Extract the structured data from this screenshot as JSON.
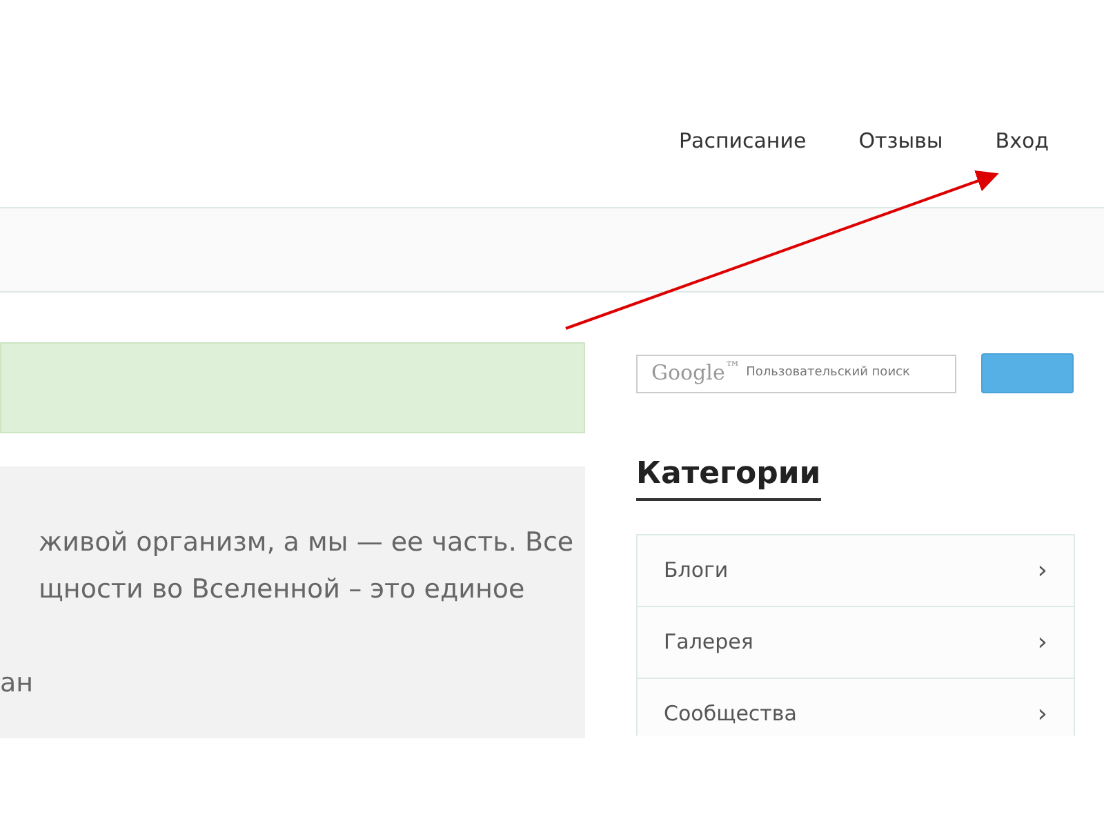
{
  "nav": [
    {
      "label": "Расписание"
    },
    {
      "label": "Отзывы"
    },
    {
      "label": "Вход"
    }
  ],
  "content": {
    "lines": [
      "живой организм, а мы — ее часть. Все",
      "щности во Вселенной – это единое"
    ],
    "tail_line": "ан"
  },
  "search": {
    "logo": "Google$^{™}$",
    "placeholder": "Пользовательский поиск"
  },
  "categories": {
    "title": "Категории",
    "items": [
      {
        "label": "Блоги",
        "chevron": "›"
      },
      {
        "label": "Галерея",
        "chevron": "›"
      },
      {
        "label": "Сообщества",
        "chevron": "›"
      }
    ]
  }
}
